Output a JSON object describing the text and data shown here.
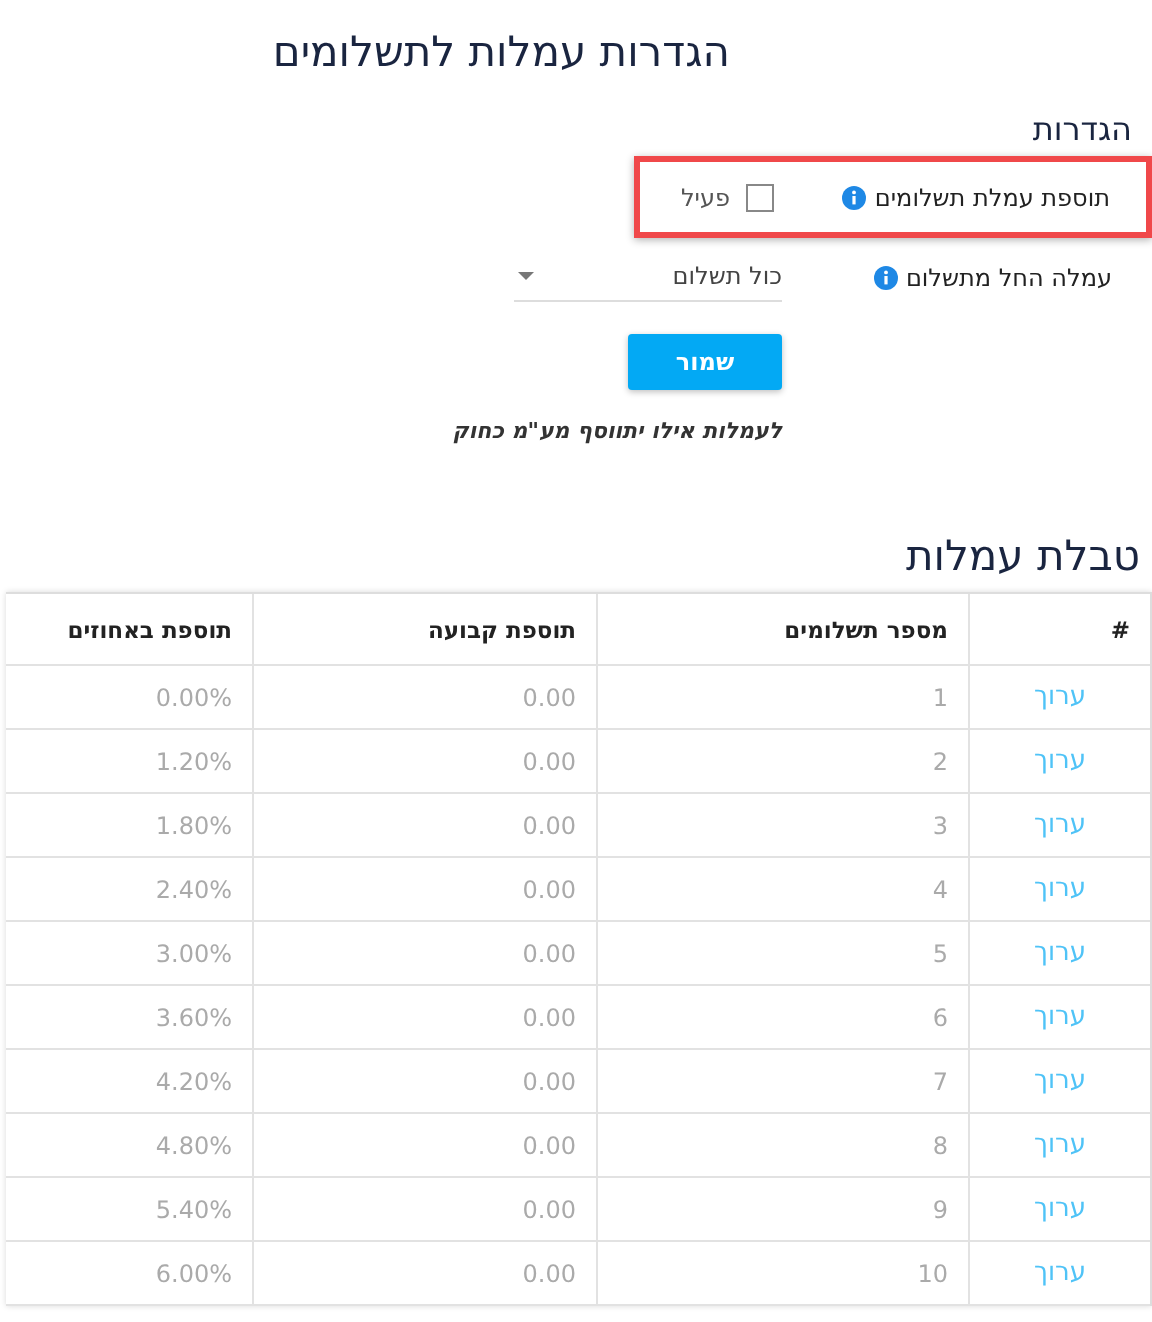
{
  "page_title": "הגדרות עמלות לתשלומים",
  "settings": {
    "title": "הגדרות",
    "commission_toggle": {
      "label": "תוספת עמלת תשלומים",
      "checkbox_label": "פעיל",
      "checked": false,
      "highlighted": true
    },
    "start_from": {
      "label": "עמלה החל מתשלום",
      "value": "כול תשלום"
    },
    "save_button": "שמור",
    "note": "לעמלות אילו יתווסף מע\"מ כחוק"
  },
  "table": {
    "title": "טבלת עמלות",
    "columns": [
      "#",
      "מספר תשלומים",
      "תוספת קבועה",
      "תוספת באחוזים"
    ],
    "rows": [
      {
        "action": "ערוך",
        "payments": "1",
        "fixed": "0.00",
        "percent": "0.00%"
      },
      {
        "action": "ערוך",
        "payments": "2",
        "fixed": "0.00",
        "percent": "1.20%"
      },
      {
        "action": "ערוך",
        "payments": "3",
        "fixed": "0.00",
        "percent": "1.80%"
      },
      {
        "action": "ערוך",
        "payments": "4",
        "fixed": "0.00",
        "percent": "2.40%"
      },
      {
        "action": "ערוך",
        "payments": "5",
        "fixed": "0.00",
        "percent": "3.00%"
      },
      {
        "action": "ערוך",
        "payments": "6",
        "fixed": "0.00",
        "percent": "3.60%"
      },
      {
        "action": "ערוך",
        "payments": "7",
        "fixed": "0.00",
        "percent": "4.20%"
      },
      {
        "action": "ערוך",
        "payments": "8",
        "fixed": "0.00",
        "percent": "4.80%"
      },
      {
        "action": "ערוך",
        "payments": "9",
        "fixed": "0.00",
        "percent": "5.40%"
      },
      {
        "action": "ערוך",
        "payments": "10",
        "fixed": "0.00",
        "percent": "6.00%"
      }
    ]
  }
}
